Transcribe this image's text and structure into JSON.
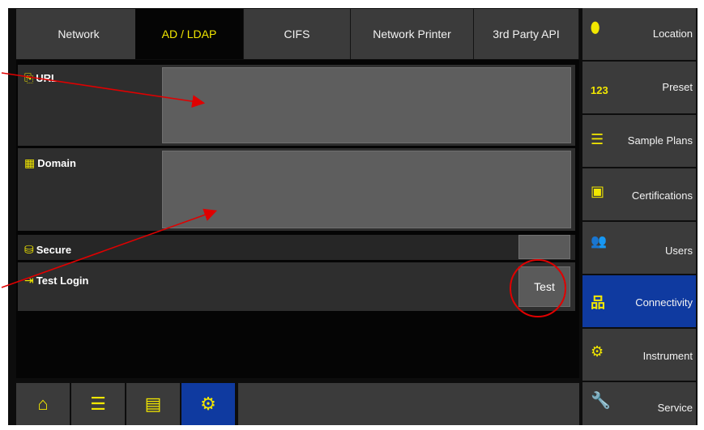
{
  "tabs": [
    {
      "label": "Network"
    },
    {
      "label": "AD / LDAP"
    },
    {
      "label": "CIFS"
    },
    {
      "label": "Network Printer"
    },
    {
      "label": "3rd Party API"
    }
  ],
  "fields": {
    "url_label": "URL",
    "domain_label": "Domain",
    "secure_label": "Secure",
    "test_login_label": "Test Login",
    "test_button": "Test"
  },
  "sidebar": [
    {
      "label": "Location",
      "icon": "location-pin-icon",
      "glyph": "⬮"
    },
    {
      "label": "Preset",
      "icon": "preset-123-icon",
      "glyph": "123"
    },
    {
      "label": "Sample Plans",
      "icon": "sample-plans-icon",
      "glyph": "☰"
    },
    {
      "label": "Certifications",
      "icon": "certificate-icon",
      "glyph": "▣"
    },
    {
      "label": "Users",
      "icon": "users-icon",
      "glyph": "👥"
    },
    {
      "label": "Connectivity",
      "icon": "network-icon",
      "glyph": "品"
    },
    {
      "label": "Instrument",
      "icon": "instrument-icon",
      "glyph": "⚙"
    },
    {
      "label": "Service",
      "icon": "wrench-icon",
      "glyph": "🔧"
    }
  ],
  "bottom_bar": [
    {
      "icon": "home-icon",
      "glyph": "⌂"
    },
    {
      "icon": "list-icon",
      "glyph": "☰"
    },
    {
      "icon": "document-icon",
      "glyph": "▤"
    },
    {
      "icon": "gear-icon",
      "glyph": "⚙"
    }
  ],
  "colors": {
    "accent": "#f2e700",
    "active_blue": "#0f3aa0",
    "annotation_red": "#e00000"
  }
}
